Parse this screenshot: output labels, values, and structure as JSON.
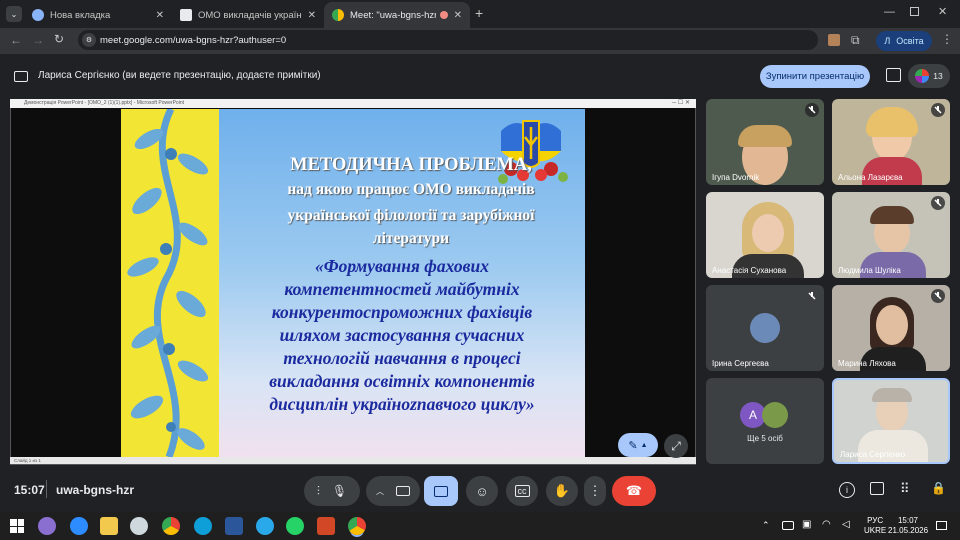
{
  "browser": {
    "tabs": [
      {
        "label": "Нова вкладка",
        "icon": "globe-icon"
      },
      {
        "label": "ОМО викладачів української ф",
        "icon": "document-icon"
      },
      {
        "label": "Meet: \"uwa-bgns-hzr\"",
        "icon": "meet-icon"
      }
    ],
    "new_tab_label": "+",
    "url": "meet.google.com/uwa-bgns-hzr?authuser=0",
    "profile_initial": "Л",
    "profile_label": "Освіта"
  },
  "meet": {
    "presenter_text": "Лариса Сергієнко (ви ведете презентацію, додаєте примітки)",
    "stop_button": "Зупинити презентацію",
    "participant_count": "13",
    "meeting_time": "15:07",
    "meeting_code": "uwa-bgns-hzr",
    "participants": [
      {
        "name": "Ігупа Dvornik",
        "muted": true
      },
      {
        "name": "Альона Лазарєва",
        "muted": true
      },
      {
        "name": "Анастасія Суханова",
        "muted": false
      },
      {
        "name": "Людмила Шуліка",
        "muted": true
      },
      {
        "name": "Ірина Сергеєва",
        "muted": true
      },
      {
        "name": "Марина Ляхова",
        "muted": true
      },
      {
        "name": "Ще 5 осіб",
        "muted": false,
        "initial": "А"
      },
      {
        "name": "Лариса Сергієнко",
        "muted": false
      }
    ]
  },
  "powerpoint": {
    "title": "Демонстрація PowerPoint - [ОМО_2 (1)(1).pptx] - Microsoft PowerPoint",
    "status": "Слайд 1 из 1"
  },
  "slide": {
    "title_lines": [
      "МЕТОДИЧНА ПРОБЛЕМА,",
      "над якою працює ОМО викладачів",
      "української філології та зарубіжної",
      "літератури"
    ],
    "body_lines": [
      "«Формування фахових",
      "компетентностей майбутніх",
      "конкурентоспроможних фахівців",
      "шляхом застосування сучасних",
      "технологій навчання в процесі",
      "викладання освітніх компонентів",
      "дисциплін україноznавчого циклу»"
    ]
  },
  "taskbar": {
    "lang": "РУС",
    "layout": "UKRE",
    "time": "15:07",
    "date": "21.05.2026"
  }
}
